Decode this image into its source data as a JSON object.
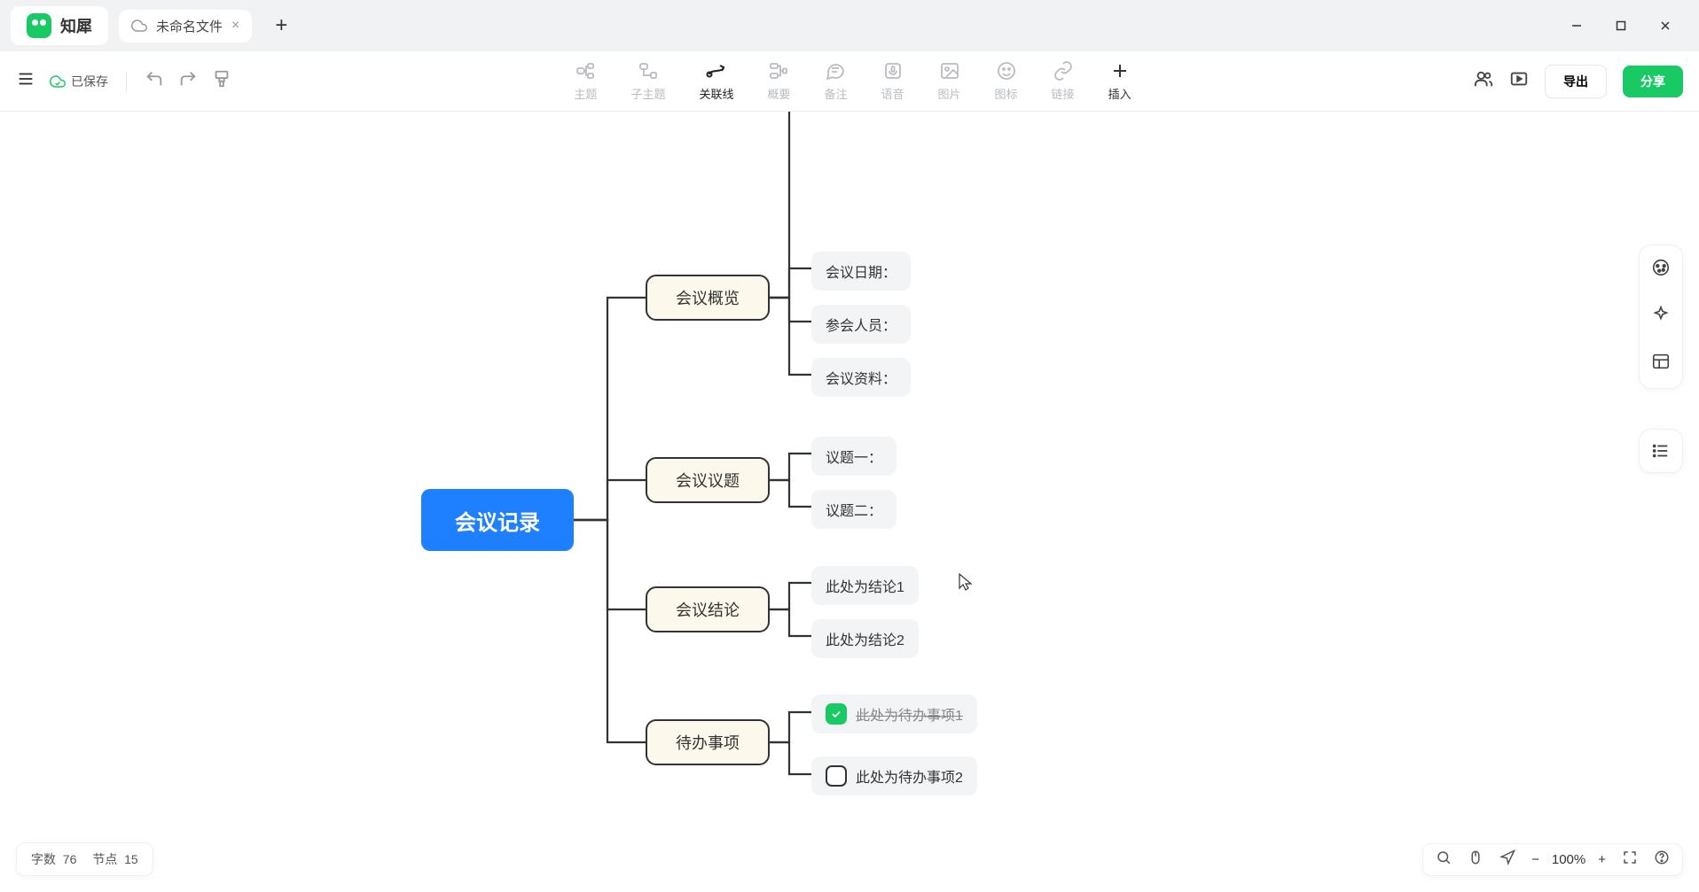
{
  "app": {
    "name": "知犀"
  },
  "tab": {
    "filename": "未命名文件"
  },
  "save_state": "已保存",
  "tools": {
    "topic": "主题",
    "subtopic": "子主题",
    "relation": "关联线",
    "summary": "概要",
    "note": "备注",
    "audio": "语音",
    "image": "图片",
    "icon": "图标",
    "link": "链接",
    "insert": "插入"
  },
  "buttons": {
    "export": "导出",
    "share": "分享"
  },
  "mindmap": {
    "root": "会议记录",
    "b1": "会议概览",
    "b2": "会议议题",
    "b3": "会议结论",
    "b4": "待办事项",
    "l1a": "会议日期：",
    "l1b": "参会人员：",
    "l1c": "会议资料：",
    "l2a": "议题一：",
    "l2b": "议题二：",
    "l3a": "此处为结论1",
    "l3b": "此处为结论2",
    "l4a": "此处为待办事项1",
    "l4b": "此处为待办事项2"
  },
  "status": {
    "wc_label": "字数",
    "wc_value": "76",
    "nc_label": "节点",
    "nc_value": "15",
    "zoom": "100%"
  }
}
